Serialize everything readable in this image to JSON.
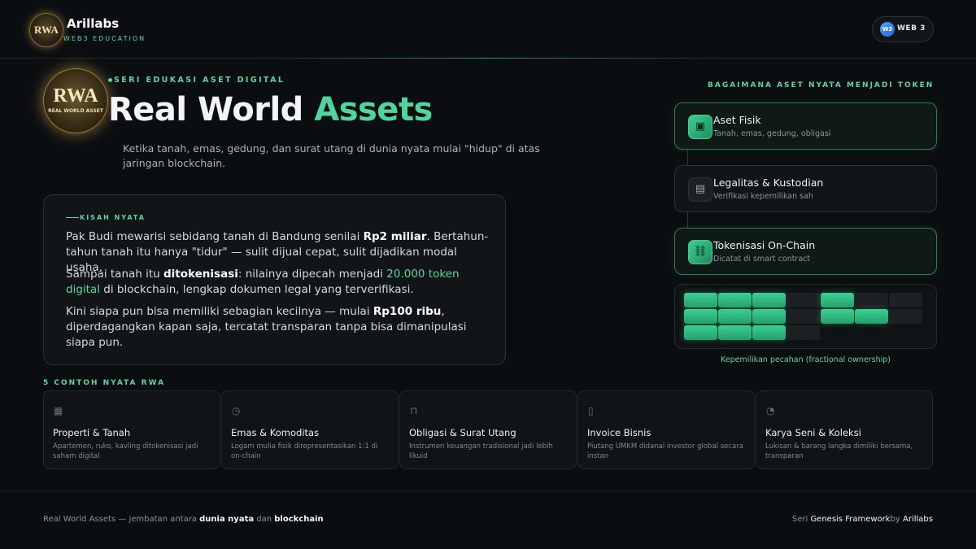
{
  "header": {
    "logo_text": "RWA",
    "brand": "Arillabs",
    "brand_sub": "WEB3 EDUCATION",
    "pill_icon": "W3",
    "pill_label": "WEB 3"
  },
  "hero": {
    "badge_big": "RWA",
    "badge_small": "REAL WORLD ASSET",
    "series": "SERI EDUKASI ASET DIGITAL",
    "title_main": "Real World ",
    "title_accent": "Assets",
    "subtitle": "Ketika tanah, emas, gedung, dan surat utang di dunia nyata mulai \"hidup\" di atas jaringan blockchain."
  },
  "story": {
    "tag": "KISAH NYATA",
    "p1_a": "Pak Budi mewarisi sebidang tanah di Bandung senilai ",
    "p1_b": "Rp2 miliar",
    "p1_c": ". Bertahun-tahun tanah itu hanya \"tidur\" — sulit dijual cepat, sulit dijadikan modal usaha.",
    "p2_a": "Sampai tanah itu ",
    "p2_b": "ditokenisasi",
    "p2_c": ": nilainya dipecah menjadi ",
    "p2_d": "20.000 token digital",
    "p2_e": " di blockchain, lengkap dokumen legal yang terverifikasi.",
    "p3_a": "Kini siapa pun bisa memiliki sebagian kecilnya — mulai ",
    "p3_b": "Rp100 ribu",
    "p3_c": ", diperdagangkan kapan saja, tercatat transparan tanpa bisa dimanipulasi siapa pun."
  },
  "flow": {
    "heading": "BAGAIMANA ASET NYATA MENJADI TOKEN",
    "steps": [
      {
        "title": "Aset Fisik",
        "sub": "Tanah, emas, gedung, obligasi",
        "icon": "building-icon",
        "active": true
      },
      {
        "title": "Legalitas & Kustodian",
        "sub": "Verifikasi kepemilikan sah",
        "icon": "document-icon",
        "active": false
      },
      {
        "title": "Tokenisasi On-Chain",
        "sub": "Dicatat di smart contract",
        "icon": "chain-link-icon",
        "active": true
      }
    ],
    "grid_caption": "Kepemilikan pecahan (fractional ownership)"
  },
  "examples": {
    "heading": "5 CONTOH NYATA RWA",
    "items": [
      {
        "title": "Properti & Tanah",
        "desc": "Apartemen, ruko, kavling ditokenisasi jadi saham digital",
        "icon": "building-icon"
      },
      {
        "title": "Emas & Komoditas",
        "desc": "Logam mulia fisik direpresentasikan 1:1 di on-chain",
        "icon": "medal-icon"
      },
      {
        "title": "Obligasi & Surat Utang",
        "desc": "Instrumen keuangan tradisional jadi lebih likuid",
        "icon": "bank-icon"
      },
      {
        "title": "Invoice Bisnis",
        "desc": "Piutang UMKM didanai investor global secara instan",
        "icon": "invoice-icon"
      },
      {
        "title": "Karya Seni & Koleksi",
        "desc": "Lukisan & barang langka dimiliki bersama, transparan",
        "icon": "palette-icon"
      }
    ]
  },
  "footer": {
    "left_a": "Real World Assets — jembatan antara ",
    "left_b": "dunia nyata",
    "left_c": " dan ",
    "left_d": "blockchain",
    "right_a": "Seri ",
    "right_b": "Genesis Framework",
    "right_c": "by ",
    "right_d": "Arillabs"
  }
}
